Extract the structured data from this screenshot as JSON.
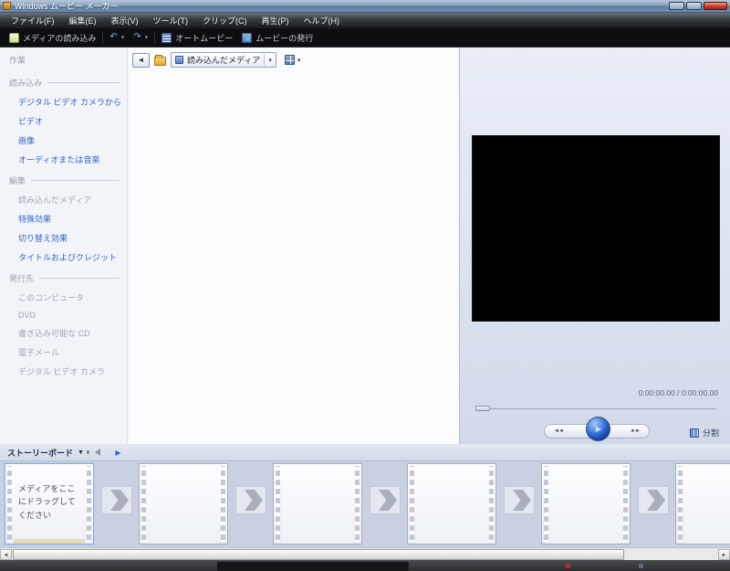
{
  "window": {
    "title": "Windows ムービー メーカー"
  },
  "menu": {
    "items": [
      "ファイル(F)",
      "編集(E)",
      "表示(V)",
      "ツール(T)",
      "クリップ(C)",
      "再生(P)",
      "ヘルプ(H)"
    ]
  },
  "toolbar": {
    "import": "メディアの読み込み",
    "automovie": "オートムービー",
    "publish": "ムービーの発行"
  },
  "icons": {
    "undo": "↶",
    "redo": "↷",
    "dropdown": "▾",
    "back": "◄",
    "storyboard_caret": "▼",
    "prev_frame": "◄◄",
    "next_frame": "►►",
    "play": "▶",
    "scroll_left": "◄",
    "scroll_right": "►"
  },
  "tasks": {
    "title": "作業",
    "sections": [
      {
        "header": "読み込み",
        "items": [
          {
            "label": "デジタル ビデオ カメラから"
          },
          {
            "label": "ビデオ"
          },
          {
            "label": "画像"
          },
          {
            "label": "オーディオまたは音楽"
          }
        ]
      },
      {
        "header": "編集",
        "items": [
          {
            "label": "読み込んだメディア"
          },
          {
            "label": "特殊効果"
          },
          {
            "label": "切り替え効果"
          },
          {
            "label": "タイトルおよびクレジット"
          }
        ]
      },
      {
        "header": "発行先",
        "items": [
          {
            "label": "このコンピュータ"
          },
          {
            "label": "DVD"
          },
          {
            "label": "書き込み可能な CD"
          },
          {
            "label": "電子メール"
          },
          {
            "label": "デジタル ビデオ カメラ"
          }
        ]
      }
    ]
  },
  "contents": {
    "location": "読み込んだメディア"
  },
  "preview": {
    "time": "0:00:00.00 / 0:00:00.00",
    "split": "分割"
  },
  "storyboard": {
    "label": "ストーリーボード",
    "dropzone": "メディアをここにドラッグしてください"
  },
  "colors": {
    "link_blue": "#3565c1",
    "play_button_blue": "#2f6bd8",
    "titlebar_blue": "#6e8cae",
    "storyboard_bg": "#c9d0e0"
  }
}
